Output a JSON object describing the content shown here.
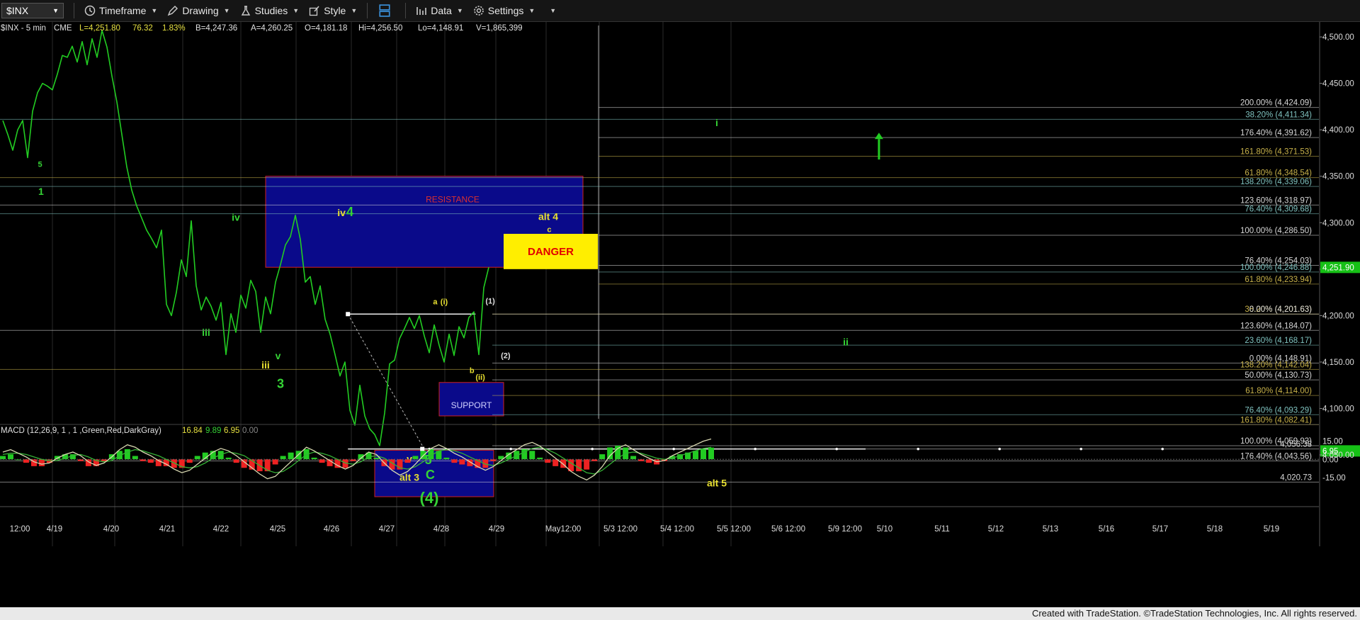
{
  "toolbar": {
    "symbol": "$INX",
    "timeframe": "Timeframe",
    "drawing": "Drawing",
    "studies": "Studies",
    "style": "Style",
    "data": "Data",
    "settings": "Settings"
  },
  "header": {
    "symbol": "$INX - 5 min",
    "exchange": "CME",
    "last": "L=4,251.80",
    "change": "76.32",
    "change_pct": "1.83%",
    "bid": "B=4,247.36",
    "ask": "A=4,260.25",
    "open": "O=4,181.18",
    "high": "Hi=4,256.50",
    "low": "Lo=4,148.91",
    "volume": "V=1,865,399"
  },
  "colors": {
    "background": "#000000",
    "price_line": "#22cc22",
    "wave_green": "#35d335",
    "wave_yellow": "#e8e030",
    "box_blue": "#0a0a8a",
    "box_border": "#d02020",
    "danger_fill": "#ffee00",
    "danger_text": "#e00000",
    "last_price_bg": "#16c016",
    "macd_line": "#d8d8b0",
    "macd_signal": "#35b035",
    "hist_up": "#22cc22",
    "hist_down": "#ee2222"
  },
  "chart_data": {
    "type": "line",
    "title": "$INX - 5 min",
    "y_axis": {
      "ticks": [
        "4,500.00",
        "4,450.00",
        "4,400.00",
        "4,350.00",
        "4,300.00",
        "4,250.00",
        "4,200.00",
        "4,150.00",
        "4,100.00",
        "4,050.00"
      ],
      "ylim": [
        4005,
        4510
      ],
      "last_price_label": "4,251.90",
      "last_price": 4251.9
    },
    "x_axis": {
      "ticks": [
        "12:00",
        "4/19",
        "4/20",
        "4/21",
        "4/22",
        "4/25",
        "4/26",
        "4/27",
        "4/28",
        "4/29",
        "May12:00",
        "5/3 12:00",
        "5/4 12:00",
        "5/5 12:00",
        "5/6 12:00",
        "5/9 12:00",
        "5/10",
        "5/11",
        "5/12",
        "5/13",
        "5/16",
        "5/17",
        "5/18",
        "5/19"
      ]
    },
    "price_series": {
      "name": "$INX",
      "points": [
        [
          0,
          4410
        ],
        [
          1,
          4395
        ],
        [
          2,
          4378
        ],
        [
          3,
          4400
        ],
        [
          4,
          4410
        ],
        [
          5,
          4370
        ],
        [
          6,
          4420
        ],
        [
          7,
          4440
        ],
        [
          8,
          4450
        ],
        [
          9,
          4447
        ],
        [
          10,
          4443
        ],
        [
          11,
          4460
        ],
        [
          12,
          4480
        ],
        [
          13,
          4478
        ],
        [
          14,
          4490
        ],
        [
          15,
          4473
        ],
        [
          16,
          4495
        ],
        [
          17,
          4470
        ],
        [
          18,
          4498
        ],
        [
          19,
          4478
        ],
        [
          20,
          4507
        ],
        [
          21,
          4489
        ],
        [
          22,
          4458
        ],
        [
          23,
          4430
        ],
        [
          24,
          4395
        ],
        [
          25,
          4360
        ],
        [
          26,
          4335
        ],
        [
          27,
          4318
        ],
        [
          28,
          4305
        ],
        [
          29,
          4292
        ],
        [
          30,
          4283
        ],
        [
          31,
          4273
        ],
        [
          32,
          4292
        ],
        [
          33,
          4212
        ],
        [
          34,
          4200
        ],
        [
          35,
          4225
        ],
        [
          36,
          4260
        ],
        [
          37,
          4242
        ],
        [
          38,
          4302
        ],
        [
          39,
          4232
        ],
        [
          40,
          4206
        ],
        [
          41,
          4220
        ],
        [
          42,
          4210
        ],
        [
          43,
          4195
        ],
        [
          44,
          4214
        ],
        [
          45,
          4158
        ],
        [
          46,
          4202
        ],
        [
          47,
          4182
        ],
        [
          48,
          4222
        ],
        [
          49,
          4208
        ],
        [
          50,
          4238
        ],
        [
          51,
          4226
        ],
        [
          52,
          4182
        ],
        [
          53,
          4220
        ],
        [
          54,
          4202
        ],
        [
          55,
          4236
        ],
        [
          56,
          4255
        ],
        [
          57,
          4276
        ],
        [
          58,
          4285
        ],
        [
          59,
          4308
        ],
        [
          60,
          4282
        ],
        [
          61,
          4236
        ],
        [
          62,
          4242
        ],
        [
          63,
          4212
        ],
        [
          64,
          4232
        ],
        [
          65,
          4196
        ],
        [
          66,
          4180
        ],
        [
          67,
          4158
        ],
        [
          68,
          4135
        ],
        [
          69,
          4150
        ],
        [
          70,
          4098
        ],
        [
          71,
          4082
        ],
        [
          72,
          4125
        ],
        [
          73,
          4092
        ],
        [
          74,
          4078
        ],
        [
          75,
          4072
        ],
        [
          76,
          4060
        ],
        [
          77,
          4095
        ],
        [
          78,
          4148
        ],
        [
          79,
          4152
        ],
        [
          80,
          4175
        ],
        [
          81,
          4186
        ],
        [
          82,
          4198
        ],
        [
          83,
          4186
        ],
        [
          84,
          4200
        ],
        [
          85,
          4178
        ],
        [
          86,
          4160
        ],
        [
          87,
          4190
        ],
        [
          88,
          4168
        ],
        [
          89,
          4150
        ],
        [
          90,
          4180
        ],
        [
          91,
          4157
        ],
        [
          92,
          4188
        ],
        [
          93,
          4176
        ],
        [
          94,
          4198
        ],
        [
          95,
          4204
        ],
        [
          96,
          4158
        ],
        [
          97,
          4230
        ],
        [
          98,
          4251.9
        ]
      ]
    },
    "horizontal_levels": [
      {
        "label": "200.00% (4,424.09)",
        "value": 4424.09,
        "color": "#d8d8d8"
      },
      {
        "label": "38.20% (4,411.34)",
        "value": 4411.34,
        "color": "#7fc2bf"
      },
      {
        "label": "176.40% (4,391.62)",
        "value": 4391.62,
        "color": "#d8d8d8"
      },
      {
        "label": "161.80% (4,371.53)",
        "value": 4371.53,
        "color": "#c8b24a"
      },
      {
        "label": "61.80% (4,348.54)",
        "value": 4348.54,
        "color": "#c8b24a"
      },
      {
        "label": "138.20% (4,339.06)",
        "value": 4339.06,
        "color": "#7fc2bf"
      },
      {
        "label": "123.60% (4,318.97)",
        "value": 4318.97,
        "color": "#d8d8d8"
      },
      {
        "label": "76.40% (4,309.68)",
        "value": 4309.68,
        "color": "#7fc2bf"
      },
      {
        "label": "100.00% (4,286.50)",
        "value": 4286.5,
        "color": "#d8d8d8"
      },
      {
        "label": "76.40% (4,254.03)",
        "value": 4254.03,
        "color": "#d8d8d8"
      },
      {
        "label": "100.00% (4,246.88)",
        "value": 4246.88,
        "color": "#7fc2bf"
      },
      {
        "label": "61.80% (4,233.94)",
        "value": 4233.94,
        "color": "#c8b24a"
      },
      {
        "label": "38.20% (4,201.63)",
        "value": 4201.63,
        "color": "#c8b24a"
      },
      {
        "label": "0.00% (4,201.63)",
        "value": 4201.63,
        "color": "#d8d8d8"
      },
      {
        "label": "123.60% (4,184.07)",
        "value": 4184.07,
        "color": "#d8d8d8"
      },
      {
        "label": "23.60% (4,168.17)",
        "value": 4168.17,
        "color": "#7fc2bf"
      },
      {
        "label": "0.00% (4,148.91)",
        "value": 4148.91,
        "color": "#d8d8d8"
      },
      {
        "label": "138.20% (4,142.04)",
        "value": 4142.04,
        "color": "#c8b24a"
      },
      {
        "label": "50.00% (4,130.73)",
        "value": 4130.73,
        "color": "#d8d8d8"
      },
      {
        "label": "61.80% (4,114.00)",
        "value": 4114.0,
        "color": "#c8b24a"
      },
      {
        "label": "76.40% (4,093.29)",
        "value": 4093.29,
        "color": "#7fc2bf"
      },
      {
        "label": "161.80% (4,082.41)",
        "value": 4082.41,
        "color": "#c8b24a"
      },
      {
        "label": "100.00% (4,059.93)",
        "value": 4059.93,
        "color": "#d8d8d8"
      },
      {
        "label": "4,056.38",
        "value": 4056.38,
        "color": "#d8d8d8"
      },
      {
        "label": "176.40% (4,043.56)",
        "value": 4043.56,
        "color": "#d8d8d8"
      },
      {
        "label": "4,020.73",
        "value": 4020.73,
        "color": "#d8d8d8"
      }
    ],
    "zones": [
      {
        "label": "RESISTANCE",
        "from_x": 53,
        "to_x": 117,
        "top": 4350,
        "bottom": 4252
      },
      {
        "label": "SUPPORT",
        "from_x": 88,
        "to_x": 101,
        "top": 4128,
        "bottom": 4092
      },
      {
        "label": "",
        "from_x": 75,
        "to_x": 99,
        "top": 4055,
        "bottom": 4005
      }
    ],
    "danger_box": {
      "label": "DANGER",
      "from_x": 101,
      "to_x": 120,
      "top": 4288,
      "bottom": 4250
    },
    "wave_labels": [
      {
        "text": "5",
        "x": 7.5,
        "y": 4360,
        "color": "green",
        "size": "small"
      },
      {
        "text": "1",
        "x": 7.7,
        "y": 4330,
        "color": "green",
        "size": "mid"
      },
      {
        "text": "iv",
        "x": 47,
        "y": 4302,
        "color": "green",
        "size": "mid"
      },
      {
        "text": "iii",
        "x": 41,
        "y": 4178,
        "color": "green",
        "size": "mid"
      },
      {
        "text": "iii",
        "x": 53,
        "y": 4143,
        "color": "yellow",
        "size": "mid"
      },
      {
        "text": "v",
        "x": 55.5,
        "y": 4153,
        "color": "green",
        "size": "mid"
      },
      {
        "text": "3",
        "x": 56,
        "y": 4122,
        "color": "green",
        "size": "big"
      },
      {
        "text": "iv",
        "x": 68.3,
        "y": 4307,
        "color": "yellow",
        "size": "mid"
      },
      {
        "text": "4",
        "x": 70,
        "y": 4307,
        "color": "green",
        "size": "big"
      },
      {
        "text": "v",
        "x": 82,
        "y": 4042,
        "color": "yellow",
        "size": "mid"
      },
      {
        "text": "5",
        "x": 85.8,
        "y": 4040,
        "color": "green",
        "size": "big"
      },
      {
        "text": "C",
        "x": 86.2,
        "y": 4024,
        "color": "green",
        "size": "big"
      },
      {
        "text": "alt 3",
        "x": 82,
        "y": 4022,
        "color": "yellow",
        "size": "mid"
      },
      {
        "text": "(4)",
        "x": 86,
        "y": 3998,
        "color": "green",
        "size": "huge"
      },
      {
        "text": "a",
        "x": 87.2,
        "y": 4212,
        "color": "yellow",
        "size": "small"
      },
      {
        "text": "(i)",
        "x": 89,
        "y": 4212,
        "color": "yellow",
        "size": "small"
      },
      {
        "text": "b",
        "x": 94.6,
        "y": 4138,
        "color": "yellow",
        "size": "small"
      },
      {
        "text": "(ii)",
        "x": 96.3,
        "y": 4131,
        "color": "yellow",
        "size": "small"
      },
      {
        "text": "(1)",
        "x": 98.3,
        "y": 4213,
        "color": "white",
        "size": "small"
      },
      {
        "text": "(2)",
        "x": 101.4,
        "y": 4154,
        "color": "white",
        "size": "small"
      },
      {
        "text": "alt 4",
        "x": 110,
        "y": 4303,
        "color": "yellow",
        "size": "mid"
      },
      {
        "text": "c",
        "x": 110.2,
        "y": 4290,
        "color": "yellow",
        "size": "small"
      },
      {
        "text": "i",
        "x": 144,
        "y": 4404,
        "color": "green",
        "size": "mid"
      },
      {
        "text": "ii",
        "x": 170,
        "y": 4168,
        "color": "green",
        "size": "mid"
      },
      {
        "text": "alt 5",
        "x": 144,
        "y": 4016,
        "color": "yellow",
        "size": "mid"
      }
    ],
    "projection": {
      "from": [
        69.6,
        4201.6
      ],
      "to": [
        84.6,
        4060
      ],
      "baseline_value": 4056.4,
      "baseline_to_x": 174
    },
    "arrow_up": {
      "x": 176.7,
      "from": 4368,
      "to": 4390
    },
    "macd": {
      "label": "MACD (12,26,9, 1 , 1 ,Green,Red,DarkGray)",
      "values": [
        "16.84",
        "9.89",
        "6.95",
        "0.00"
      ],
      "ticks": [
        "15.00",
        "0.00",
        "-15.00"
      ],
      "ylim": [
        -22,
        20
      ],
      "last_label": "6.95",
      "macd_series": [
        6,
        8,
        5,
        2,
        -2,
        -4,
        -3,
        1,
        4,
        6,
        3,
        -2,
        -5,
        -3,
        2,
        8,
        12,
        10,
        6,
        3,
        -1,
        -4,
        -8,
        -11,
        -9,
        -4,
        1,
        6,
        9,
        7,
        3,
        -2,
        -7,
        -12,
        -16,
        -14,
        -8,
        -2,
        4,
        10,
        7,
        3,
        -1,
        -5,
        -8,
        -5,
        1,
        6,
        4,
        -3,
        -9,
        -13,
        -10,
        -4,
        3,
        9,
        12,
        9,
        5,
        2,
        -2,
        -6,
        -9,
        -6,
        -1,
        4,
        8,
        12,
        14,
        11,
        6,
        1,
        -4,
        -10,
        -14,
        -17,
        -13,
        -6,
        3,
        9,
        12,
        8,
        4,
        1,
        -2,
        -1,
        3,
        6,
        9,
        12,
        15,
        16.8
      ],
      "signal_series": [
        4,
        5,
        5,
        4,
        2,
        0,
        -1,
        -1,
        1,
        3,
        4,
        2,
        -1,
        -2,
        -1,
        3,
        6,
        8,
        7,
        5,
        3,
        0,
        -3,
        -6,
        -7,
        -6,
        -3,
        1,
        4,
        6,
        5,
        3,
        -1,
        -5,
        -9,
        -11,
        -10,
        -6,
        -1,
        4,
        6,
        5,
        3,
        0,
        -3,
        -4,
        -2,
        2,
        3,
        1,
        -3,
        -7,
        -8,
        -6,
        -2,
        3,
        7,
        8,
        7,
        5,
        2,
        -1,
        -4,
        -5,
        -3,
        0,
        3,
        6,
        9,
        10,
        8,
        5,
        1,
        -3,
        -7,
        -11,
        -12,
        -9,
        -4,
        1,
        5,
        6,
        5,
        3,
        1,
        0,
        1,
        3,
        5,
        7,
        9,
        9.89
      ]
    }
  },
  "footer": {
    "text": "Created with TradeStation. ©TradeStation Technologies, Inc. All rights reserved."
  }
}
